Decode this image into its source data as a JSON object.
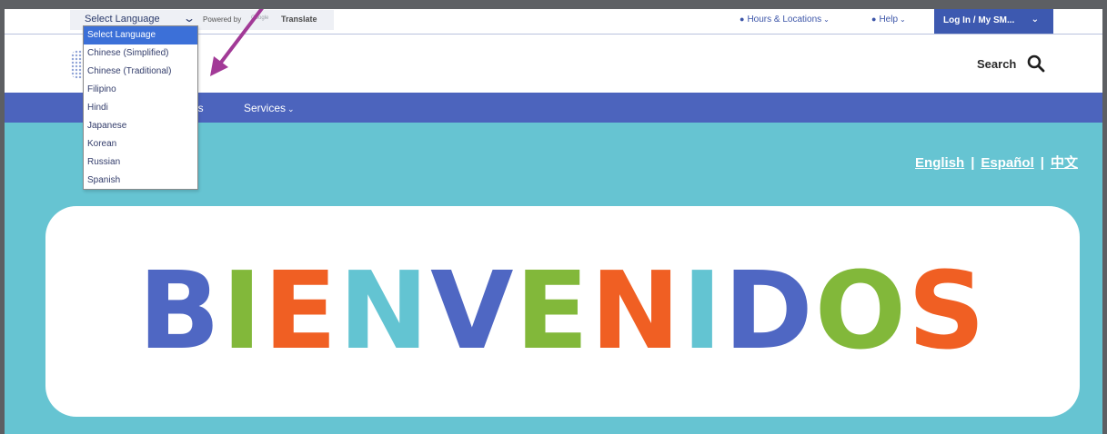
{
  "language_widget": {
    "select_label": "Select Language",
    "powered_by": "Powered by",
    "google": "Google",
    "translate": "Translate",
    "options": [
      "Select Language",
      "Chinese (Simplified)",
      "Chinese (Traditional)",
      "Filipino",
      "Hindi",
      "Japanese",
      "Korean",
      "Russian",
      "Spanish"
    ],
    "selected_index": 0
  },
  "utility_nav": {
    "hours_locations": "Hours & Locations",
    "help": "Help",
    "login": "Log In / My SM..."
  },
  "header": {
    "search_label": "Search"
  },
  "main_nav": {
    "items": [
      "ents",
      "Services"
    ]
  },
  "hero": {
    "languages": [
      "English",
      "Español",
      "中文"
    ],
    "welcome_letters": [
      {
        "char": "B",
        "color": "#4f67c3"
      },
      {
        "char": "I",
        "color": "#82b83a"
      },
      {
        "char": "E",
        "color": "#f05f23"
      },
      {
        "char": "N",
        "color": "#63c4d2"
      },
      {
        "char": "V",
        "color": "#4f67c3"
      },
      {
        "char": "E",
        "color": "#82b83a"
      },
      {
        "char": "N",
        "color": "#f05f23"
      },
      {
        "char": "I",
        "color": "#63c4d2"
      },
      {
        "char": "D",
        "color": "#4f67c3"
      },
      {
        "char": "O",
        "color": "#82b83a"
      },
      {
        "char": "S",
        "color": "#f05f23"
      }
    ]
  },
  "colors": {
    "nav_blue": "#4c64bd",
    "hero_teal": "#66c4d2",
    "arrow_magenta": "#a23a97",
    "dropdown_selected": "#3c70d8"
  }
}
